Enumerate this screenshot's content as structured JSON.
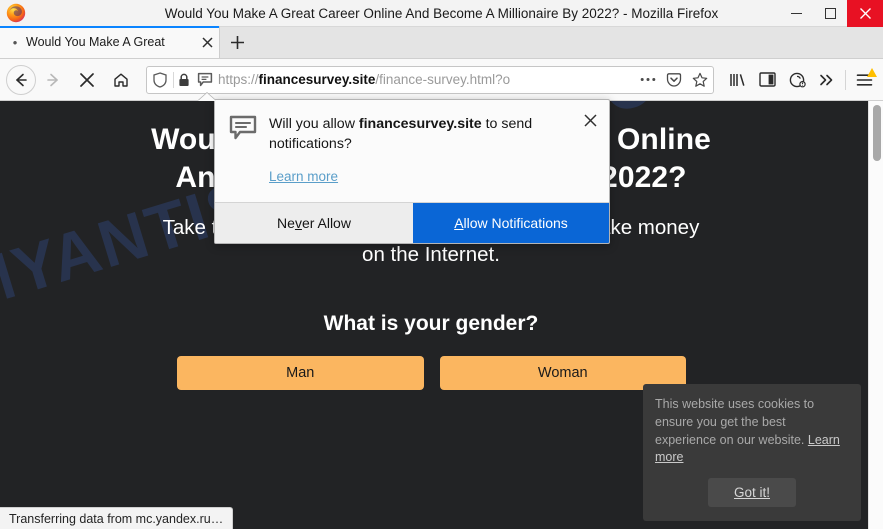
{
  "window": {
    "title": "Would You Make A Great Career Online And Become A Millionaire By 2022? - Mozilla Firefox",
    "minimize_label": "—",
    "maximize_label": "□",
    "close_label": "✕"
  },
  "tabs": {
    "items": [
      {
        "label": "Would You Make A Great",
        "close_label": "✕",
        "loading": true
      }
    ],
    "new_tab_label": "+"
  },
  "toolbar": {
    "back_label": "Back",
    "forward_label": "Forward",
    "stop_label": "Stop",
    "home_label": "Home",
    "library_label": "Library",
    "sidebar_label": "Sidebar",
    "account_label": "Account",
    "overflow_label": "More tools",
    "menu_label": "Open application menu"
  },
  "urlbar": {
    "scheme": "https://",
    "host": "financesurvey.site",
    "path": "/finance-survey.html?o",
    "full_url": "https://financesurvey.site/finance-survey.html?o",
    "page_actions_label": "•••",
    "pocket_label": "Save to Pocket",
    "bookmark_label": "Bookmark this page"
  },
  "doorhanger": {
    "message_prefix": "Will you allow ",
    "message_host": "financesurvey.site",
    "message_suffix": " to send notifications?",
    "learn_more": "Learn more",
    "close_label": "✕",
    "never_allow": "Never Allow",
    "never_allow_accesskey": "v",
    "allow": "Allow Notifications",
    "allow_accesskey": "A",
    "primary_color": "#0a66d6"
  },
  "page": {
    "watermark": "MYANTISPYWARE.COM",
    "headline_line1": "Would You Make A Great Career Online",
    "headline_line2": "And Become A Millionaire By 2022?",
    "subtext_line1": "Take this FREE test and find out how you can make money",
    "subtext_line2": "on the Internet.",
    "question": "What is your gender?",
    "answers": [
      {
        "label": "Man"
      },
      {
        "label": "Woman"
      }
    ],
    "background_color": "#222325",
    "answer_color": "#fbb660"
  },
  "cookie_notice": {
    "text": "This website uses cookies to ensure you get the best experience on our website. ",
    "learn_more": "Learn more",
    "button_label": "Got it!"
  },
  "statusbar": {
    "text": "Transferring data from mc.yandex.ru…"
  }
}
